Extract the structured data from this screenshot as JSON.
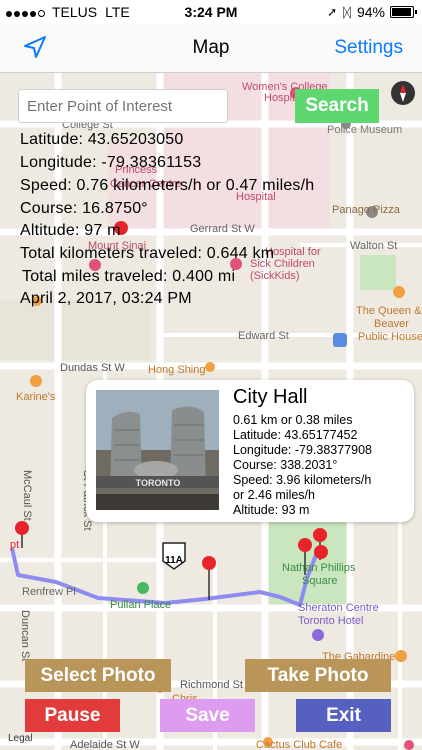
{
  "status_bar": {
    "carrier": "TELUS",
    "network": "LTE",
    "time": "3:24 PM",
    "battery": "94%",
    "battery_fraction": 0.94,
    "signal_bars": 4
  },
  "nav": {
    "title": "Map",
    "settings_label": "Settings"
  },
  "search": {
    "placeholder": "Enter Point of Interest",
    "button_label": "Search"
  },
  "tracking": {
    "latitude": "Latitude: 43.65203050",
    "longitude": "Longitude: -79.38361153",
    "speed": "Speed: 0.76 kilometers/h or 0.47 miles/h",
    "course": "Course: 16.8750°",
    "altitude": "Altitude: 97 m",
    "total_km": "Total kilometers traveled: 0.644 km",
    "total_miles": "Total miles traveled: 0.400 mi",
    "timestamp": "April 2, 2017, 03:24 PM"
  },
  "callout": {
    "title": "City Hall",
    "distance": "0.61 km or 0.38 miles",
    "latitude": "Latitude: 43.65177452",
    "longitude": "Longitude: -79.38377908",
    "course": "Course: 338.2031°",
    "speed_line1": "Speed: 3.96 kilometers/h",
    "speed_line2": "or 2.46 miles/h",
    "altitude": "Altitude: 93 m",
    "photo_sign": "TORONTO"
  },
  "map_labels": {
    "womens_college": "Women's College",
    "hospital_partial": "Hospit",
    "college_st": "College St",
    "police_museum": "Police Museum",
    "princess": "Princess",
    "cancer_centre": "Cancer Centre",
    "hospital": "Hospital",
    "panago": "Panago Pizza",
    "gerrard_st": "Gerrard St W",
    "mount_sinai": "Mount Sinai",
    "hospital_for": "Hospital for",
    "sick_children": "Sick Children",
    "sickkids": "(SickKids)",
    "walton_st": "Walton St",
    "queen_and": "The Queen &",
    "beaver": "Beaver",
    "public_house": "Public House",
    "edward_st": "Edward St",
    "dundas_st": "Dundas St W",
    "hong_shing": "Hong Shing",
    "karines": "Karine's",
    "mccaul_st": "McCaul St",
    "st_patrick_st": "St Patrick St",
    "renfrew_pl": "Renfrew Pl",
    "pt_partial": "pt",
    "duncan_st": "Duncan St",
    "pullan_place": "Pullan Place",
    "nathan_phillips": "Nathan Phillips",
    "square": "Square",
    "sheraton": "Sheraton Centre",
    "toronto_hotel": "Toronto Hotel",
    "the_gabardine": "The Gabardine",
    "richmond_st": "Richmond St W",
    "chris_partial": "Chris",
    "cactus_club": "Cactus Club Cafe",
    "adelaide_st": "Adelaide St W",
    "route_shield": "11A"
  },
  "buttons": {
    "select_photo": "Select Photo",
    "take_photo": "Take Photo",
    "pause": "Pause",
    "save": "Save",
    "exit": "Exit"
  },
  "legal": "Legal",
  "colors": {
    "ios_blue": "#0a7aff",
    "search_green": "#5fd770",
    "photo_gold": "#b9955a",
    "pause_red": "#e23b3b",
    "save_violet": "#dd9cf0",
    "exit_indigo": "#5560c0",
    "route_blue": "#8e8cf0",
    "hospital_red": "#e0547a",
    "park_green": "#c9e6bf"
  }
}
